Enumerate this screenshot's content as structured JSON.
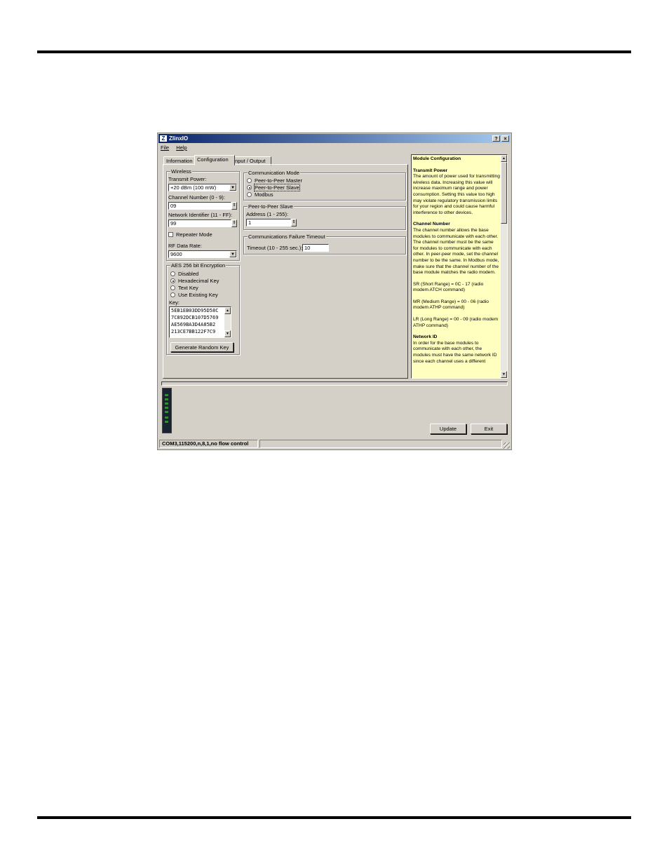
{
  "window": {
    "title": "ZlinxIO",
    "help_btn": "?",
    "close_btn": "×"
  },
  "menu": {
    "file": "File",
    "help": "Help"
  },
  "tabs": [
    "Information",
    "Configuration",
    "Input / Output"
  ],
  "wireless": {
    "group_label": "Wireless",
    "transmit_power_label": "Transmit Power:",
    "transmit_power_value": "+20 dBm (100 mW)",
    "channel_label": "Channel Number (0 - 9):",
    "channel_value": "09",
    "network_label": "Network Identifier (11 - FF):",
    "network_value": "99",
    "repeater_label": "Repeater Mode",
    "rf_rate_label": "RF Data Rate:",
    "rf_rate_value": "9600"
  },
  "aes": {
    "group_label": "AES 256 bit Encryption",
    "options": [
      "Disabled",
      "Hexadecimal Key",
      "Text Key",
      "Use Existing Key"
    ],
    "key_label": "Key:",
    "key_lines": [
      "5EB1EB03DD95D58C",
      "7C892DCB107D5769",
      "AE569BA3D4A85B2",
      "213CE7BB122F7C9"
    ],
    "generate_btn": "Generate Random Key"
  },
  "comm_mode": {
    "group_label": "Communication Mode",
    "options": [
      "Peer-to-Peer Master",
      "Peer-to-Peer Slave",
      "Modbus"
    ]
  },
  "p2p_slave": {
    "group_label": "Peer-to-Peer Slave",
    "address_label": "Address (1 - 255):",
    "address_value": "1"
  },
  "comm_failure": {
    "group_label": "Communications Failure Timeout",
    "timeout_label": "Timeout (10 - 255 sec.):",
    "timeout_value": "10"
  },
  "help_panel": {
    "title": "Module Configuration",
    "sections": [
      {
        "heading": "Transmit Power",
        "text": "The amount of power used for transmitting wireless data.  Increasing this value will increase maximum range and power consumption.  Setting this value too high may violate regulatory transmission limits for your region and could cause harmful interference to other devices."
      },
      {
        "heading": "Channel Number",
        "text": "The channel number allows the base modules to communicate with each other.  The channel number must be the same for modules to communicate with each other. In peer-peer mode, set the channel number to be the same. In Modbus mode, make sure that the channel number of the base module matches the radio modem."
      },
      {
        "heading": "",
        "text": "SR (Short Range) = 0C - 17 (radio modem ATCH command)"
      },
      {
        "heading": "",
        "text": "MR (Medium Range) = 00 - 06 (radio modem ATHP command)"
      },
      {
        "heading": "",
        "text": "LR (Long Range) = 00 - 09 (radio modem ATHP command)"
      },
      {
        "heading": "Network ID",
        "text": "In order for the base modules to communicate with each other, the modules must have the same network ID since each channel uses a different"
      }
    ]
  },
  "buttons": {
    "update": "Update",
    "exit": "Exit"
  },
  "statusbar": {
    "connection": "COM3,115200,n,8,1,no flow control"
  }
}
